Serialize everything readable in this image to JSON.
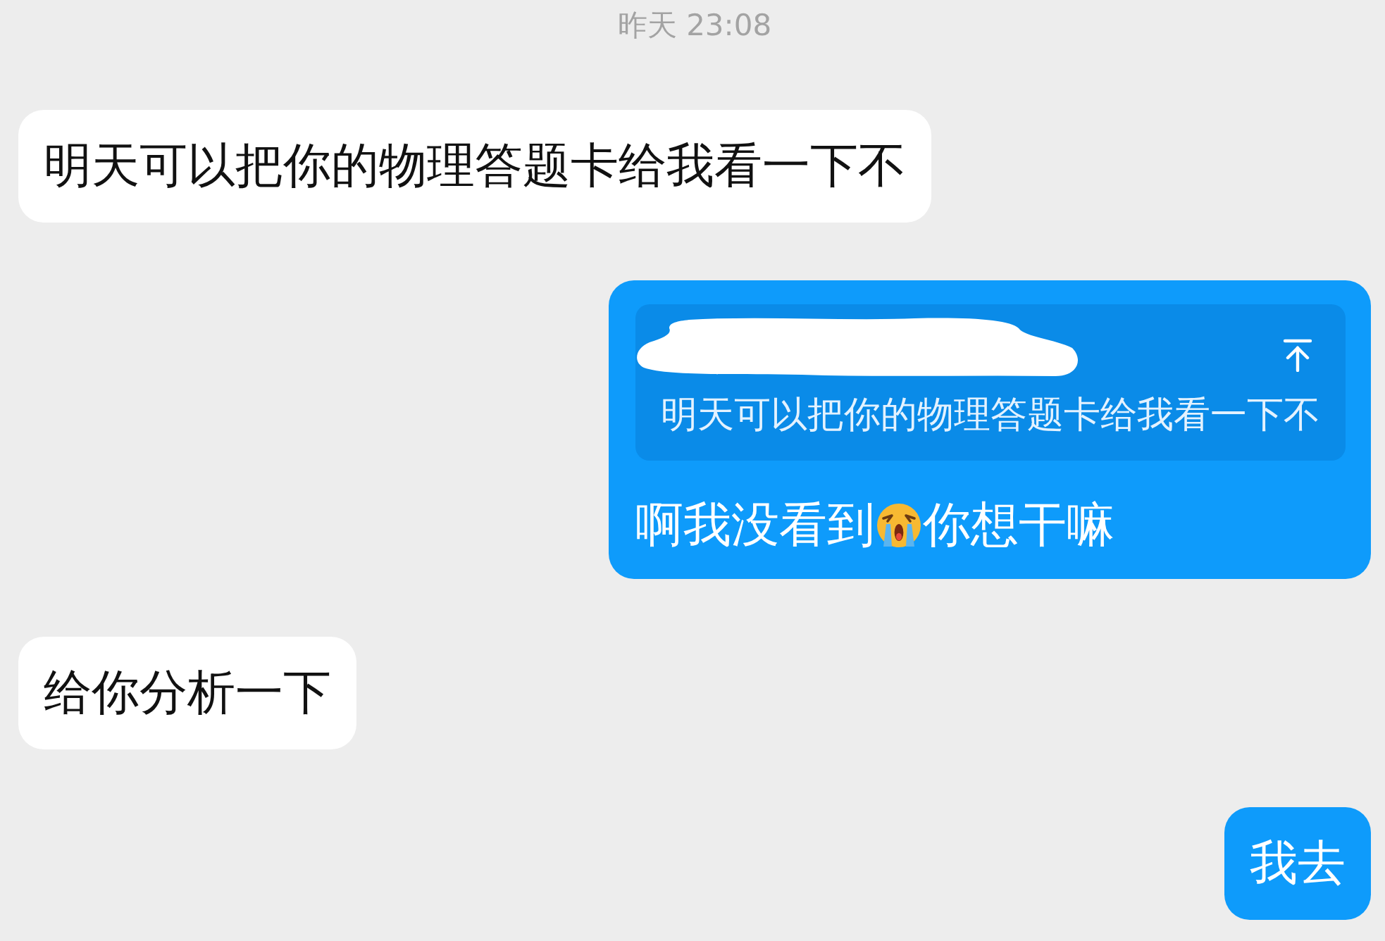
{
  "timestamp": "昨天 23:08",
  "messages": [
    {
      "outgoing": false,
      "segments": [
        {
          "kind": "text",
          "text": "明天可以把你的物理答题卡给我看一下不"
        }
      ]
    },
    {
      "outgoing": true,
      "quote": {
        "author_redacted": true,
        "text": "明天可以把你的物理答题卡给我看一下不"
      },
      "segments": [
        {
          "kind": "text",
          "text": "啊我没看到"
        },
        {
          "kind": "emoji"
        },
        {
          "kind": "text",
          "text": "你想干嘛"
        }
      ]
    },
    {
      "outgoing": false,
      "segments": [
        {
          "kind": "text",
          "text": "给你分析一下"
        }
      ]
    },
    {
      "outgoing": true,
      "segments": [
        {
          "kind": "text",
          "text": "我去"
        }
      ]
    }
  ]
}
